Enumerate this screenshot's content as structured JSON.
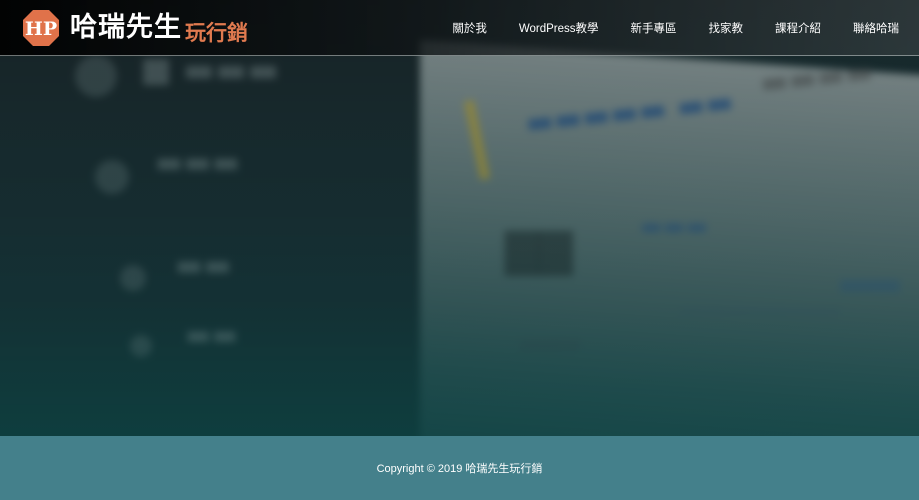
{
  "site": {
    "logo": {
      "icon": "hp-octagon-logo-icon",
      "badge_text": "HP",
      "main_text": "哈瑞先生",
      "sub_text": "玩行銷",
      "badge_color": "#e0724a",
      "sub_color": "#e07a4f"
    }
  },
  "nav": {
    "items": [
      {
        "label": "關於我"
      },
      {
        "label": "WordPress教學"
      },
      {
        "label": "新手專區"
      },
      {
        "label": "找家教"
      },
      {
        "label": "課程介紹"
      },
      {
        "label": "聯絡哈瑞"
      }
    ]
  },
  "footer": {
    "copyright": "Copyright © 2019 哈瑞先生玩行銷",
    "background_color": "#44808b"
  },
  "colors": {
    "header_bg": "#000000",
    "hero_tint": "#0f4447"
  }
}
